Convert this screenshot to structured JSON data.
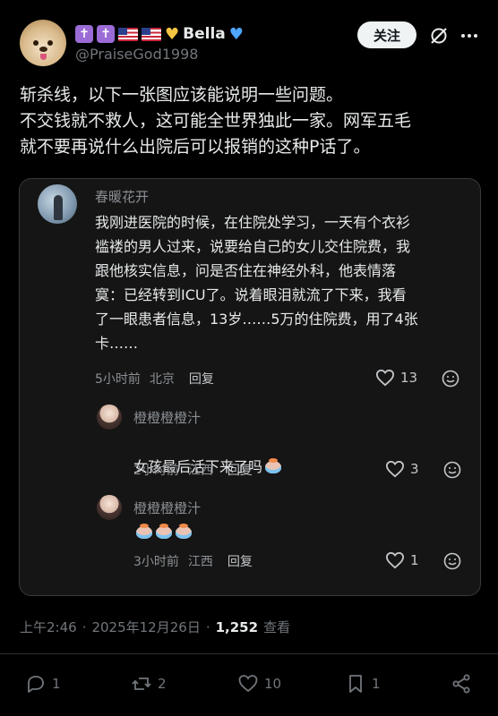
{
  "user": {
    "display_name": "Bella",
    "badges": [
      "✝",
      "✝"
    ],
    "handle": "@PraiseGod1998",
    "follow_label": "关注"
  },
  "tweet": {
    "text": "斩杀线，以下一张图应该能说明一些问题。\n不交钱就不救人，这可能全世界独此一家。网军五毛\n就不要再说什么出院后可以报销的这种P话了。"
  },
  "comments": [
    {
      "author": "春暖花开",
      "text": "我刚进医院的时候，在住院处学习，一天有个衣衫\n褴褛的男人过来，说要给自己的女儿交住院费，我\n跟他核实信息，问是否住在神经外科，他表情落\n寞：已经转到ICU了。说着眼泪就流了下来，我看\n了一眼患者信息，13岁……5万的住院费，用了4张\n卡……",
      "time": "5小时前",
      "location": "北京",
      "reply_label": "回复",
      "likes": "13"
    },
    {
      "author": "橙橙橙橙汁",
      "text": "女孩最后活下来了吗",
      "emoji_count": 1,
      "time": "2小时前",
      "location": "江西",
      "reply_label": "回复",
      "likes": "3"
    },
    {
      "author": "橙橙橙橙汁",
      "text": "",
      "emoji_count": 3,
      "time": "3小时前",
      "location": "江西",
      "reply_label": "回复",
      "likes": "1"
    }
  ],
  "meta": {
    "time": "上午2:46",
    "separator": "·",
    "date": "2025年12月26日",
    "views_count": "1,252",
    "views_label": "查看"
  },
  "actions": {
    "replies": "1",
    "retweets": "2",
    "likes": "10",
    "bookmarks": "1"
  }
}
